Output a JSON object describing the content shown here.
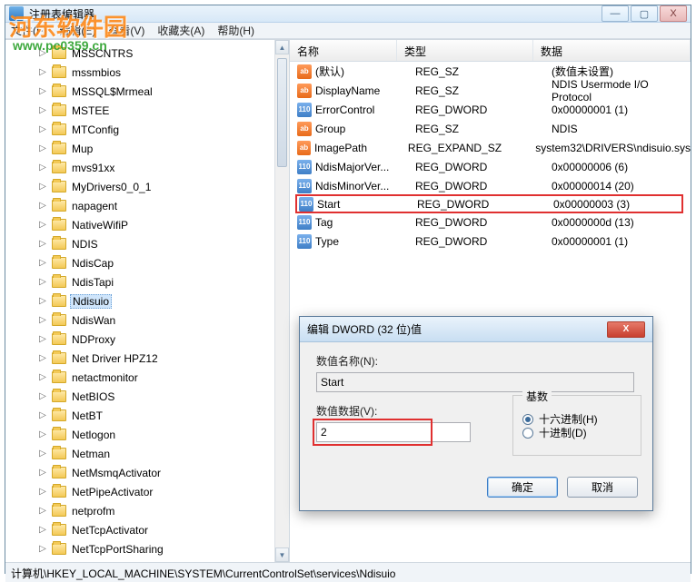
{
  "window": {
    "title": "注册表编辑器",
    "min": "—",
    "max": "▢",
    "close": "X"
  },
  "menu": {
    "file": "文件(F)",
    "edit": "编辑(E)",
    "view": "查看(V)",
    "fav": "收藏夹(A)",
    "help": "帮助(H)"
  },
  "tree": {
    "items": [
      {
        "label": "MSSCNTRS",
        "tw": "▷"
      },
      {
        "label": "mssmbios",
        "tw": "▷"
      },
      {
        "label": "MSSQL$Mrmeal",
        "tw": "▷"
      },
      {
        "label": "MSTEE",
        "tw": "▷"
      },
      {
        "label": "MTConfig",
        "tw": "▷"
      },
      {
        "label": "Mup",
        "tw": "▷"
      },
      {
        "label": "mvs91xx",
        "tw": "▷"
      },
      {
        "label": "MyDrivers0_0_1",
        "tw": "▷"
      },
      {
        "label": "napagent",
        "tw": "▷"
      },
      {
        "label": "NativeWifiP",
        "tw": "▷"
      },
      {
        "label": "NDIS",
        "tw": "▷"
      },
      {
        "label": "NdisCap",
        "tw": "▷"
      },
      {
        "label": "NdisTapi",
        "tw": "▷"
      },
      {
        "label": "Ndisuio",
        "tw": "▷",
        "sel": true
      },
      {
        "label": "NdisWan",
        "tw": "▷"
      },
      {
        "label": "NDProxy",
        "tw": "▷"
      },
      {
        "label": "Net Driver HPZ12",
        "tw": "▷"
      },
      {
        "label": "netactmonitor",
        "tw": "▷"
      },
      {
        "label": "NetBIOS",
        "tw": "▷"
      },
      {
        "label": "NetBT",
        "tw": "▷"
      },
      {
        "label": "Netlogon",
        "tw": "▷"
      },
      {
        "label": "Netman",
        "tw": "▷"
      },
      {
        "label": "NetMsmqActivator",
        "tw": "▷"
      },
      {
        "label": "NetPipeActivator",
        "tw": "▷"
      },
      {
        "label": "netprofm",
        "tw": "▷"
      },
      {
        "label": "NetTcpActivator",
        "tw": "▷"
      },
      {
        "label": "NetTcpPortSharing",
        "tw": "▷"
      }
    ]
  },
  "list": {
    "headers": {
      "name": "名称",
      "type": "类型",
      "data": "数据"
    },
    "rows": [
      {
        "icon": "str",
        "name": "(默认)",
        "type": "REG_SZ",
        "data": "(数值未设置)"
      },
      {
        "icon": "str",
        "name": "DisplayName",
        "type": "REG_SZ",
        "data": "NDIS Usermode I/O Protocol"
      },
      {
        "icon": "dw",
        "name": "ErrorControl",
        "type": "REG_DWORD",
        "data": "0x00000001 (1)"
      },
      {
        "icon": "str",
        "name": "Group",
        "type": "REG_SZ",
        "data": "NDIS"
      },
      {
        "icon": "str",
        "name": "ImagePath",
        "type": "REG_EXPAND_SZ",
        "data": "system32\\DRIVERS\\ndisuio.sys"
      },
      {
        "icon": "dw",
        "name": "NdisMajorVer...",
        "type": "REG_DWORD",
        "data": "0x00000006 (6)"
      },
      {
        "icon": "dw",
        "name": "NdisMinorVer...",
        "type": "REG_DWORD",
        "data": "0x00000014 (20)"
      },
      {
        "icon": "dw",
        "name": "Start",
        "type": "REG_DWORD",
        "data": "0x00000003 (3)",
        "hl": true
      },
      {
        "icon": "dw",
        "name": "Tag",
        "type": "REG_DWORD",
        "data": "0x0000000d (13)"
      },
      {
        "icon": "dw",
        "name": "Type",
        "type": "REG_DWORD",
        "data": "0x00000001 (1)"
      }
    ]
  },
  "dialog": {
    "title": "编辑 DWORD (32 位)值",
    "name_label": "数值名称(N):",
    "name_value": "Start",
    "data_label": "数值数据(V):",
    "data_value": "2",
    "base_label": "基数",
    "radio_hex": "十六进制(H)",
    "radio_dec": "十进制(D)",
    "ok": "确定",
    "cancel": "取消",
    "close": "X"
  },
  "statusbar": {
    "path": "计算机\\HKEY_LOCAL_MACHINE\\SYSTEM\\CurrentControlSet\\services\\Ndisuio"
  },
  "watermark": {
    "line1": "河东软件园",
    "line2": "www.pc0359.cn"
  },
  "icon_text": {
    "str": "ab",
    "dw": "110"
  }
}
